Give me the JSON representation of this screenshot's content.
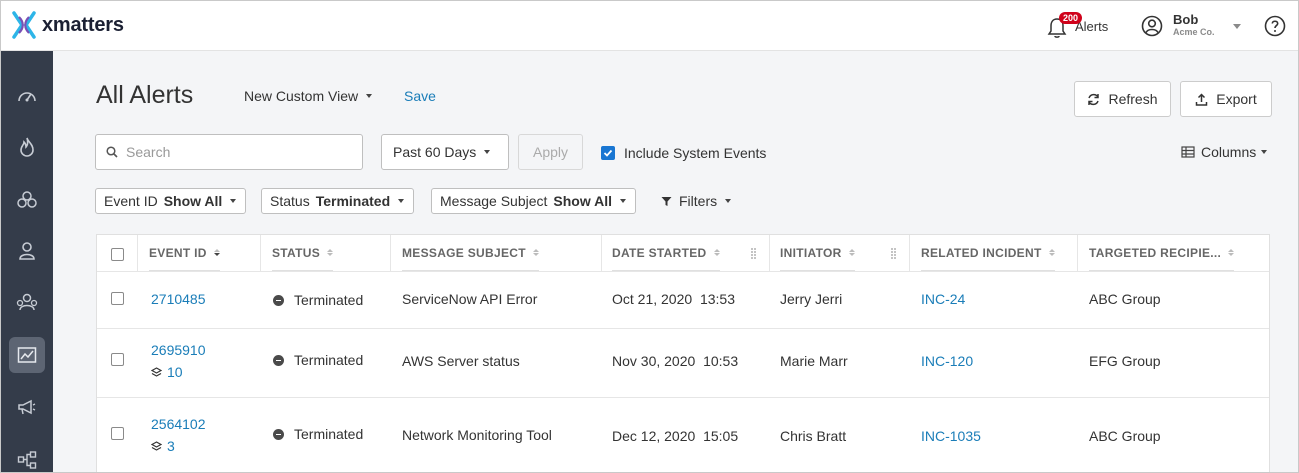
{
  "header": {
    "brand": "xmatters",
    "alerts_badge": "200",
    "alerts_label": "Alerts",
    "user_name": "Bob",
    "user_company": "Acme Co."
  },
  "sidebar": {
    "items": [
      {
        "icon": "dashboard-icon"
      },
      {
        "icon": "incidents-flame-icon"
      },
      {
        "icon": "groups-icon"
      },
      {
        "icon": "users-icon"
      },
      {
        "icon": "teams-icon"
      },
      {
        "icon": "reports-icon",
        "active": true
      },
      {
        "icon": "messaging-megaphone-icon"
      },
      {
        "icon": "workflows-icon"
      }
    ]
  },
  "page": {
    "title": "All Alerts",
    "view_label": "New Custom View",
    "save_label": "Save",
    "refresh_label": "Refresh",
    "export_label": "Export",
    "search_placeholder": "Search",
    "range_label": "Past 60 Days",
    "apply_label": "Apply",
    "include_system_events_label": "Include System Events",
    "include_system_events_checked": true,
    "columns_label": "Columns",
    "filters_label": "Filters"
  },
  "filters": [
    {
      "label": "Event ID",
      "value": "Show All"
    },
    {
      "label": "Status",
      "value": "Terminated"
    },
    {
      "label": "Message Subject",
      "value": "Show All"
    }
  ],
  "table": {
    "headers": [
      "EVENT ID",
      "STATUS",
      "MESSAGE SUBJECT",
      "DATE STARTED",
      "INITIATOR",
      "RELATED INCIDENT",
      "TARGETED RECIPIE..."
    ],
    "rows": [
      {
        "event_id": "2710485",
        "sub_count": "",
        "status": "Terminated",
        "subject": "ServiceNow API Error",
        "date": "Oct 21, 2020",
        "time": "13:53",
        "initiator": "Jerry Jerri",
        "incident": "INC-24",
        "recipients": "ABC Group"
      },
      {
        "event_id": "2695910",
        "sub_count": "10",
        "status": "Terminated",
        "subject": "AWS Server status",
        "date": "Nov 30, 2020",
        "time": "10:53",
        "initiator": "Marie Marr",
        "incident": "INC-120",
        "recipients": "EFG Group"
      },
      {
        "event_id": "2564102",
        "sub_count": "3",
        "status": "Terminated",
        "subject": "Network Monitoring Tool",
        "date": "Dec 12, 2020",
        "time": "15:05",
        "initiator": "Chris Bratt",
        "incident": "INC-1035",
        "recipients": "ABC Group"
      }
    ]
  },
  "colors": {
    "sidebar_bg": "#343c4a",
    "sidebar_active": "#5d6573",
    "link": "#1a7db8",
    "badge": "#d0021b",
    "checkbox": "#1976d2"
  }
}
